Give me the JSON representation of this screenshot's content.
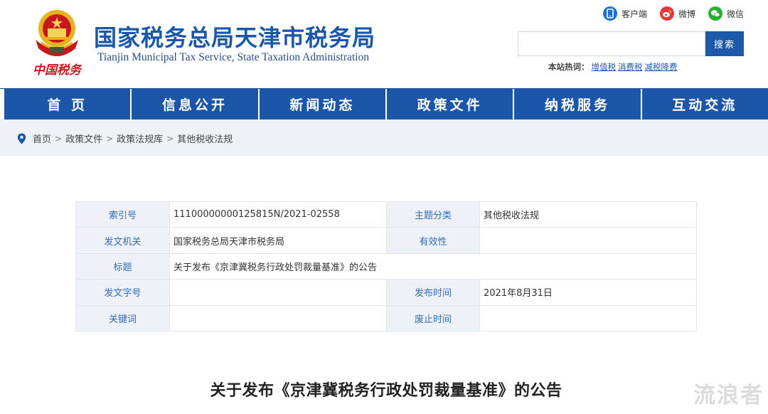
{
  "header": {
    "emblem_text": "中国税务",
    "site_title": "国家税务总局天津市税务局",
    "site_subtitle": "Tianjin Municipal Tax Service, State Taxation Administration",
    "top_links": [
      {
        "icon": "mobile-client-icon",
        "label": "客户端",
        "color": "#1c6fd0"
      },
      {
        "icon": "weibo-icon",
        "label": "微博",
        "color": "#e4393c"
      },
      {
        "icon": "wechat-icon",
        "label": "微信",
        "color": "#2aae30"
      }
    ],
    "search": {
      "placeholder": "",
      "button_label": "搜索"
    },
    "hot_words": {
      "label": "本站热词：",
      "items": [
        "增值税",
        "消费税",
        "减税降费"
      ]
    }
  },
  "nav": {
    "items": [
      "首 页",
      "信息公开",
      "新闻动态",
      "政策文件",
      "纳税服务",
      "互动交流"
    ]
  },
  "breadcrumb": {
    "items": [
      "首页",
      "政策文件",
      "政策法规库",
      "其他税收法规"
    ],
    "separator": ">"
  },
  "meta": {
    "index_label": "索引号",
    "index_value": "11100000000125815N/2021-02558",
    "topic_label": "主题分类",
    "topic_value": "其他税收法规",
    "issuer_label": "发文机关",
    "issuer_value": "国家税务总局天津市税务局",
    "validity_label": "有效性",
    "validity_value": "",
    "title_label": "标题",
    "title_value": "关于发布《京津冀税务行政处罚裁量基准》的公告",
    "docno_label": "发文字号",
    "docno_value": "",
    "publish_label": "发布时间",
    "publish_value": "2021年8月31日",
    "keyword_label": "关键词",
    "keyword_value": "",
    "abolish_label": "废止时间",
    "abolish_value": ""
  },
  "article": {
    "title": "关于发布《京津冀税务行政处罚裁量基准》的公告"
  },
  "watermark": "流浪者",
  "colors": {
    "brand_blue": "#1c56a8",
    "label_blue": "#3369b3",
    "emblem_red": "#c8161e",
    "emblem_gold": "#e8b21a"
  }
}
